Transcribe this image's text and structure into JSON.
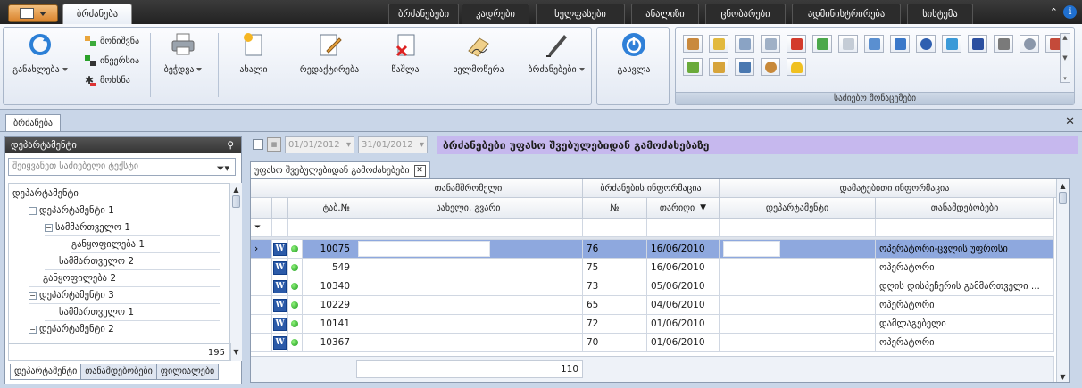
{
  "ribbon_tabs": [
    {
      "label": "ბრძანება",
      "active": true
    },
    {
      "label": "ბრძანებები"
    },
    {
      "label": "კადრები"
    },
    {
      "label": "ხელფასები"
    },
    {
      "label": "ანალიზი"
    },
    {
      "label": "ცნობარები"
    },
    {
      "label": "ადმინისტრირება"
    },
    {
      "label": "სისტემა"
    }
  ],
  "ribbon": {
    "refresh": "განახლება",
    "mark": "მონიშვნა",
    "invert": "ინვერსია",
    "unmark": "მოხსნა",
    "print": "ბეჭდვა",
    "new": "ახალი",
    "edit": "რედაქტირება",
    "delete": "წაშლა",
    "sign": "ხელმოწერა",
    "orders": "ბრძანებები",
    "exit": "გასვლა",
    "reference_group": "საძიებო მონაცემები"
  },
  "doc_tab": "ბრძანება",
  "left_panel": {
    "title": "დეპარტამენტი",
    "filter_placeholder": "შეიყვანეთ საძიებელი ტექსტი",
    "tree_header": "დეპარტამენტი",
    "tree": [
      {
        "label": "დეპარტამენტი 1",
        "level": 1,
        "expand": "−"
      },
      {
        "label": "სამმართველო 1",
        "level": 2,
        "expand": "−"
      },
      {
        "label": "განყოფილება 1",
        "level": 3
      },
      {
        "label": "სამმართველო 2",
        "level": 2
      },
      {
        "label": "განყოფილება 2",
        "level": 1
      },
      {
        "label": "დეპარტამენტი 3",
        "level": 1,
        "expand": "−"
      },
      {
        "label": "სამმართველო 1",
        "level": 2
      },
      {
        "label": "დეპარტამენტი 2",
        "level": 1,
        "expand": "−"
      }
    ],
    "count": "195",
    "bottom_tabs": [
      "დეპარტამენტი",
      "თანამდებობები",
      "ფილიალები"
    ]
  },
  "filters": {
    "date_from": "01/01/2012",
    "date_to": "31/01/2012"
  },
  "banner": "ბრძანებები უფასო შვებულებიდან გამოძახებაზე",
  "grid_tab": "უფასო შვებულებიდან გამოძახებები",
  "grid": {
    "group_employee": "თანამშრომელი",
    "group_order": "ბრძანების ინფორმაცია",
    "group_extra": "დამატებითი ინფორმაცია",
    "col_tab": "ტაბ.№",
    "col_name": "სახელი, გვარი",
    "col_num": "№",
    "col_date": "თარიღი",
    "col_dept": "დეპარტამენტი",
    "col_position": "თანამდებობები",
    "rows": [
      {
        "tab": "10075",
        "num": "76",
        "date": "16/06/2010",
        "position": "ოპერატორი-ცვლის უფროსი",
        "selected": true
      },
      {
        "tab": "549",
        "num": "75",
        "date": "16/06/2010",
        "position": "ოპერატორი"
      },
      {
        "tab": "10340",
        "num": "73",
        "date": "05/06/2010",
        "position": "დღის დისპეჩერის გამმართველი ..."
      },
      {
        "tab": "10229",
        "num": "65",
        "date": "04/06/2010",
        "position": "ოპერატორი"
      },
      {
        "tab": "10141",
        "num": "72",
        "date": "01/06/2010",
        "position": "დამლაგებელი"
      },
      {
        "tab": "10367",
        "num": "70",
        "date": "01/06/2010",
        "position": "ოპერატორი"
      }
    ],
    "footer_count": "110"
  }
}
